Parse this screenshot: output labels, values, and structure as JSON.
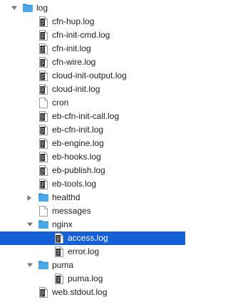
{
  "tree": {
    "rows": [
      {
        "id": "log",
        "label": "log",
        "type": "folder",
        "depth": 0,
        "expanded": true,
        "icon": "folder-icon"
      },
      {
        "id": "cfn-hup",
        "label": "cfn-hup.log",
        "type": "log-file",
        "depth": 1,
        "icon": "log-file-icon"
      },
      {
        "id": "cfn-init-cmd",
        "label": "cfn-init-cmd.log",
        "type": "log-file",
        "depth": 1,
        "icon": "log-file-icon"
      },
      {
        "id": "cfn-init",
        "label": "cfn-init.log",
        "type": "log-file",
        "depth": 1,
        "icon": "log-file-icon"
      },
      {
        "id": "cfn-wire",
        "label": "cfn-wire.log",
        "type": "log-file",
        "depth": 1,
        "icon": "log-file-icon"
      },
      {
        "id": "cloud-init-output",
        "label": "cloud-init-output.log",
        "type": "log-file",
        "depth": 1,
        "icon": "log-file-icon"
      },
      {
        "id": "cloud-init",
        "label": "cloud-init.log",
        "type": "log-file",
        "depth": 1,
        "icon": "log-file-icon"
      },
      {
        "id": "cron",
        "label": "cron",
        "type": "file",
        "depth": 1,
        "icon": "file-icon"
      },
      {
        "id": "eb-cfn-init-call",
        "label": "eb-cfn-init-call.log",
        "type": "log-file",
        "depth": 1,
        "icon": "log-file-icon"
      },
      {
        "id": "eb-cfn-init",
        "label": "eb-cfn-init.log",
        "type": "log-file",
        "depth": 1,
        "icon": "log-file-icon"
      },
      {
        "id": "eb-engine",
        "label": "eb-engine.log",
        "type": "log-file",
        "depth": 1,
        "icon": "log-file-icon"
      },
      {
        "id": "eb-hooks",
        "label": "eb-hooks.log",
        "type": "log-file",
        "depth": 1,
        "icon": "log-file-icon"
      },
      {
        "id": "eb-publish",
        "label": "eb-publish.log",
        "type": "log-file",
        "depth": 1,
        "icon": "log-file-icon"
      },
      {
        "id": "eb-tools",
        "label": "eb-tools.log",
        "type": "log-file",
        "depth": 1,
        "icon": "log-file-icon"
      },
      {
        "id": "healthd",
        "label": "healthd",
        "type": "folder",
        "depth": 1,
        "expanded": false,
        "icon": "folder-icon"
      },
      {
        "id": "messages",
        "label": "messages",
        "type": "file",
        "depth": 1,
        "icon": "file-icon"
      },
      {
        "id": "nginx",
        "label": "nginx",
        "type": "folder",
        "depth": 1,
        "expanded": true,
        "icon": "folder-icon"
      },
      {
        "id": "access",
        "label": "access.log",
        "type": "log-file",
        "depth": 2,
        "selected": true,
        "icon": "log-file-icon"
      },
      {
        "id": "error",
        "label": "error.log",
        "type": "log-file",
        "depth": 2,
        "icon": "log-file-icon"
      },
      {
        "id": "puma",
        "label": "puma",
        "type": "folder",
        "depth": 1,
        "expanded": true,
        "icon": "folder-icon"
      },
      {
        "id": "puma-log",
        "label": "puma.log",
        "type": "log-file",
        "depth": 2,
        "icon": "log-file-icon"
      },
      {
        "id": "web-stdout",
        "label": "web.stdout.log",
        "type": "log-file",
        "depth": 1,
        "icon": "log-file-icon"
      }
    ]
  },
  "colors": {
    "selection": "#1560d6",
    "folder": "#4aa7e8",
    "folder_tab": "#3b95d9",
    "disclosure": "#7a7a7a",
    "text": "#222222"
  }
}
